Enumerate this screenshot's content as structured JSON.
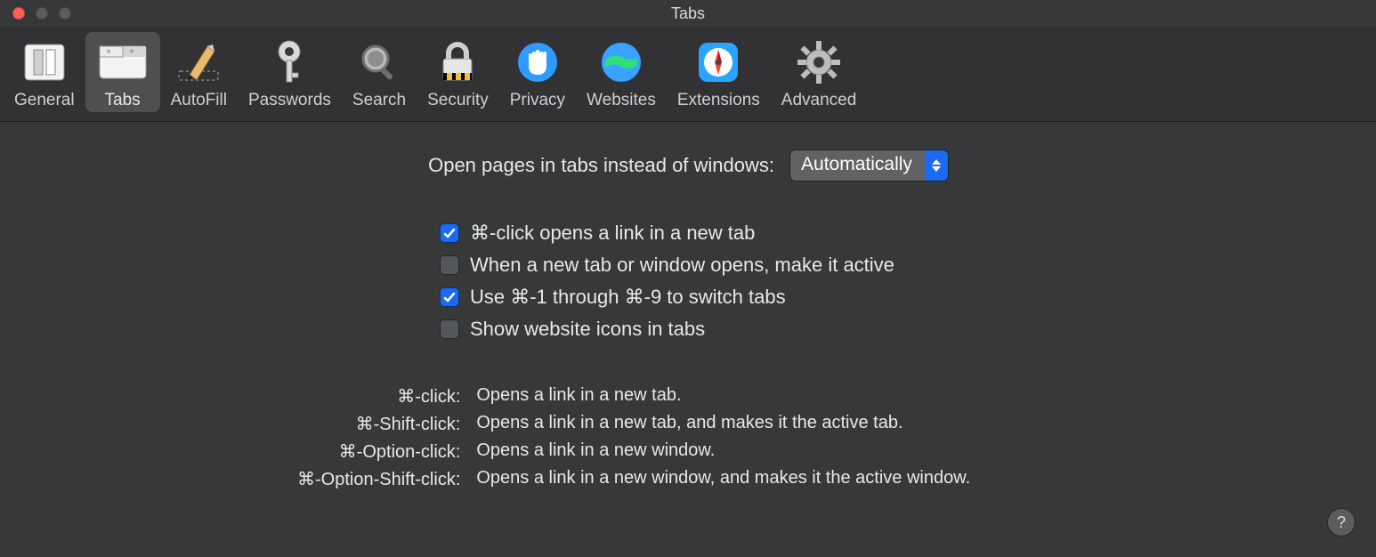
{
  "window": {
    "title": "Tabs"
  },
  "toolbar": {
    "items": [
      {
        "id": "general",
        "label": "General"
      },
      {
        "id": "tabs",
        "label": "Tabs"
      },
      {
        "id": "autofill",
        "label": "AutoFill"
      },
      {
        "id": "passwords",
        "label": "Passwords"
      },
      {
        "id": "search",
        "label": "Search"
      },
      {
        "id": "security",
        "label": "Security"
      },
      {
        "id": "privacy",
        "label": "Privacy"
      },
      {
        "id": "websites",
        "label": "Websites"
      },
      {
        "id": "extensions",
        "label": "Extensions"
      },
      {
        "id": "advanced",
        "label": "Advanced"
      }
    ],
    "selected": "tabs"
  },
  "main": {
    "open_pages_label": "Open pages in tabs instead of windows:",
    "open_pages_value": "Automatically",
    "checks": [
      {
        "label": "⌘-click opens a link in a new tab",
        "checked": true
      },
      {
        "label": "When a new tab or window opens, make it active",
        "checked": false
      },
      {
        "label": "Use ⌘-1 through ⌘-9 to switch tabs",
        "checked": true
      },
      {
        "label": "Show website icons in tabs",
        "checked": false
      }
    ],
    "shortcuts": [
      {
        "key": "⌘-click:",
        "desc": "Opens a link in a new tab."
      },
      {
        "key": "⌘-Shift-click:",
        "desc": "Opens a link in a new tab, and makes it the active tab."
      },
      {
        "key": "⌘-Option-click:",
        "desc": "Opens a link in a new window."
      },
      {
        "key": "⌘-Option-Shift-click:",
        "desc": "Opens a link in a new window, and makes it the active window."
      }
    ]
  },
  "help_tooltip": "?"
}
